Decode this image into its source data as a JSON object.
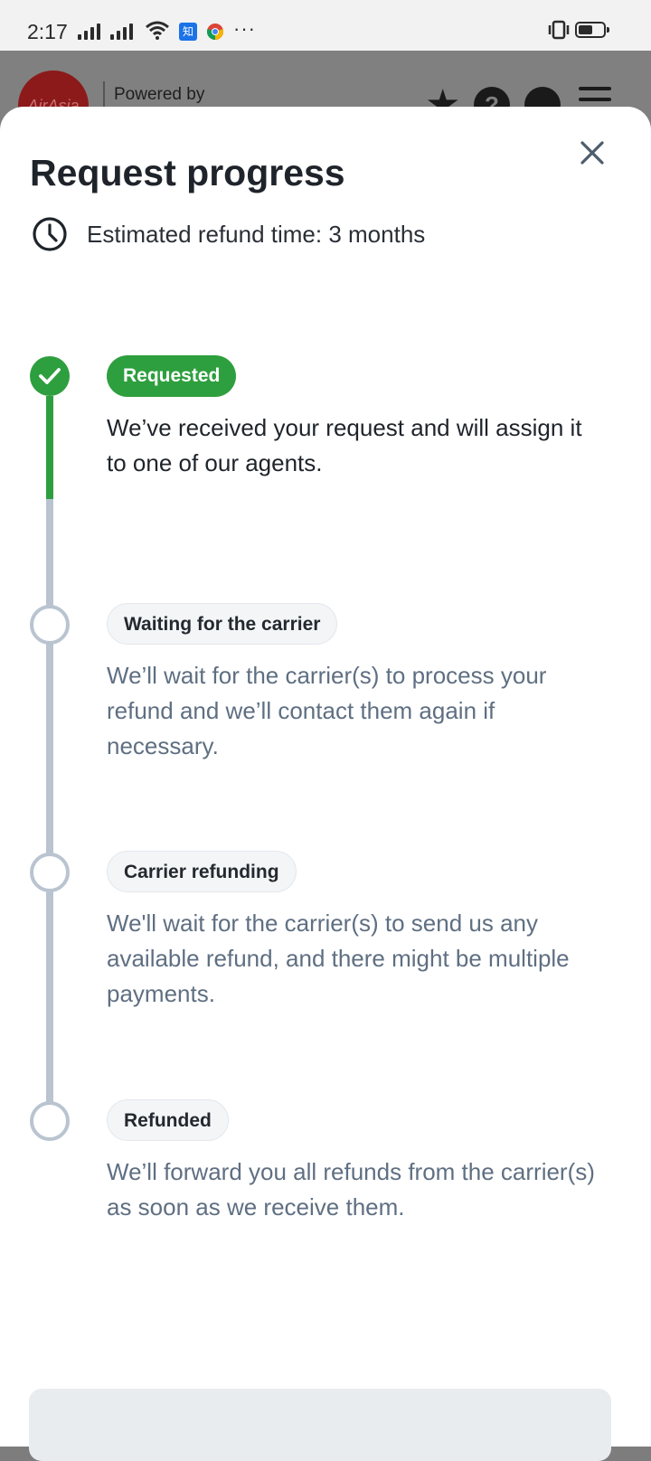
{
  "status_bar": {
    "time": "2:17",
    "app_badge": "知",
    "more": "···"
  },
  "background_header": {
    "logo_text": "AirAsia",
    "powered_by": "Powered by"
  },
  "sheet": {
    "title": "Request progress",
    "estimate": "Estimated refund time: 3 months",
    "steps": [
      {
        "label": "Requested",
        "description": "We’ve received your request and will assign it to one of our agents.",
        "state": "done"
      },
      {
        "label": "Waiting for the carrier",
        "description": "We’ll wait for the carrier(s) to process your refund and we’ll contact them again if necessary.",
        "state": "pending"
      },
      {
        "label": "Carrier refunding",
        "description": "We'll wait for the carrier(s) to send us any available refund, and there might be multiple payments.",
        "state": "pending"
      },
      {
        "label": "Refunded",
        "description": "We’ll forward you all refunds from the carrier(s) as soon as we receive them.",
        "state": "pending"
      }
    ]
  },
  "colors": {
    "accent_green": "#2e9f3e",
    "pending_gray": "#b9c4d0",
    "title_text": "#1f242b",
    "muted_text": "#5f6f82"
  },
  "icons": [
    "close-icon",
    "clock-icon",
    "check-icon",
    "star-icon",
    "help-icon",
    "user-icon",
    "menu-icon"
  ]
}
